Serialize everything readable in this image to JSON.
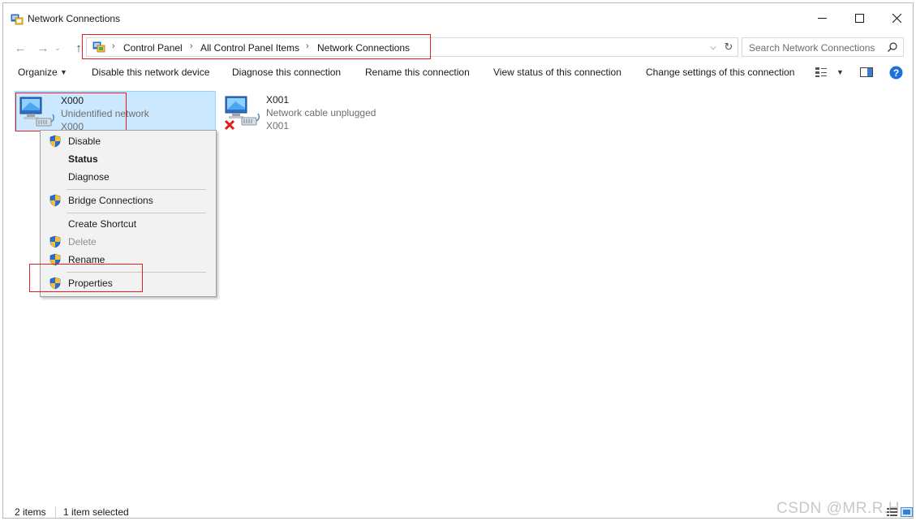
{
  "window": {
    "title": "Network Connections"
  },
  "address": {
    "crumbs": [
      "Control Panel",
      "All Control Panel Items",
      "Network Connections"
    ]
  },
  "search": {
    "placeholder": "Search Network Connections"
  },
  "toolbar": {
    "organize": "Organize",
    "disable": "Disable this network device",
    "diagnose": "Diagnose this connection",
    "rename": "Rename this connection",
    "view_status": "View status of this connection",
    "change_settings": "Change settings of this connection"
  },
  "connections": [
    {
      "name": "X000",
      "status": "Unidentified network",
      "device": "X000",
      "selected": true
    },
    {
      "name": "X001",
      "status": "Network cable unplugged",
      "device": "X001",
      "selected": false
    }
  ],
  "context_menu": {
    "items": [
      {
        "label": "Disable",
        "shield": true,
        "bold": false,
        "disabled": false
      },
      {
        "label": "Status",
        "shield": false,
        "bold": true,
        "disabled": false
      },
      {
        "label": "Diagnose",
        "shield": false,
        "bold": false,
        "disabled": false
      },
      {
        "label": "Bridge Connections",
        "shield": true,
        "bold": false,
        "disabled": false
      },
      {
        "label": "Create Shortcut",
        "shield": false,
        "bold": false,
        "disabled": false
      },
      {
        "label": "Delete",
        "shield": true,
        "bold": false,
        "disabled": true
      },
      {
        "label": "Rename",
        "shield": true,
        "bold": false,
        "disabled": false
      },
      {
        "label": "Properties",
        "shield": true,
        "bold": false,
        "disabled": false
      }
    ]
  },
  "statusbar": {
    "count": "2 items",
    "selected": "1 item selected"
  },
  "watermark": "CSDN @MR.R.H",
  "colors": {
    "selection_bg": "#cce8ff",
    "highlight_red": "#e02020",
    "help_blue": "#1e6fd9"
  }
}
